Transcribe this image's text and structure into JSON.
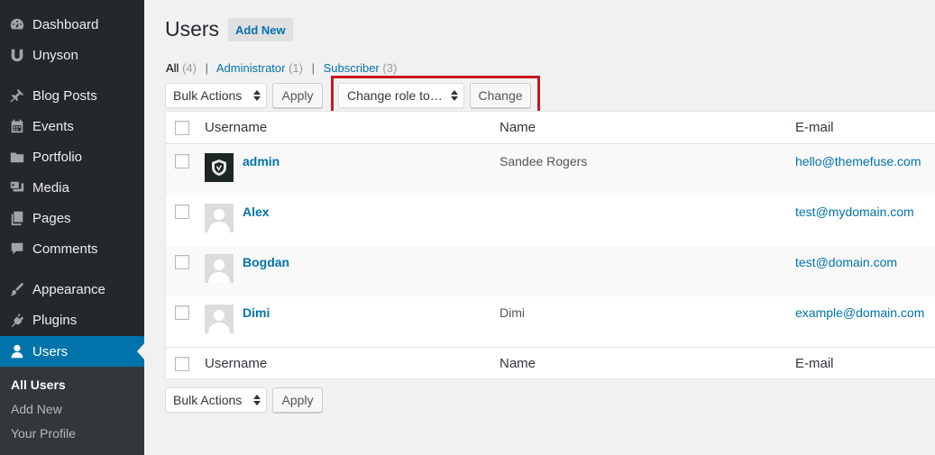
{
  "sidebar": {
    "items": [
      {
        "label": "Dashboard",
        "icon": "dashboard-icon"
      },
      {
        "label": "Unyson",
        "icon": "unyson-icon"
      },
      {
        "label": "Blog Posts",
        "icon": "pin-icon"
      },
      {
        "label": "Events",
        "icon": "calendar-icon"
      },
      {
        "label": "Portfolio",
        "icon": "folder-icon"
      },
      {
        "label": "Media",
        "icon": "media-icon"
      },
      {
        "label": "Pages",
        "icon": "pages-icon"
      },
      {
        "label": "Comments",
        "icon": "comment-icon"
      },
      {
        "label": "Appearance",
        "icon": "brush-icon"
      },
      {
        "label": "Plugins",
        "icon": "plugin-icon"
      },
      {
        "label": "Users",
        "icon": "user-icon"
      }
    ],
    "submenu": [
      "All Users",
      "Add New",
      "Your Profile"
    ]
  },
  "page": {
    "title": "Users",
    "add_new": "Add New"
  },
  "views": {
    "all": "All",
    "all_count": "(4)",
    "admin": "Administrator",
    "admin_count": "(1)",
    "subscriber": "Subscriber",
    "subscriber_count": "(3)",
    "separator": "|"
  },
  "toolbar": {
    "bulk_actions": "Bulk Actions",
    "apply": "Apply",
    "change_role": "Change role to…",
    "change": "Change"
  },
  "table": {
    "columns": [
      "Username",
      "Name",
      "E-mail"
    ],
    "rows": [
      {
        "username": "admin",
        "name": "Sandee Rogers",
        "email": "hello@themefuse.com",
        "avatar": "shield-avatar"
      },
      {
        "username": "Alex",
        "name": "",
        "email": "test@mydomain.com",
        "avatar": "default-avatar"
      },
      {
        "username": "Bogdan",
        "name": "",
        "email": "test@domain.com",
        "avatar": "default-avatar"
      },
      {
        "username": "Dimi",
        "name": "Dimi",
        "email": "example@domain.com",
        "avatar": "default-avatar"
      }
    ]
  },
  "colors": {
    "sidebar_bg": "#23282d",
    "active_bg": "#0073aa",
    "link": "#0073aa",
    "highlight": "#c9171e"
  }
}
